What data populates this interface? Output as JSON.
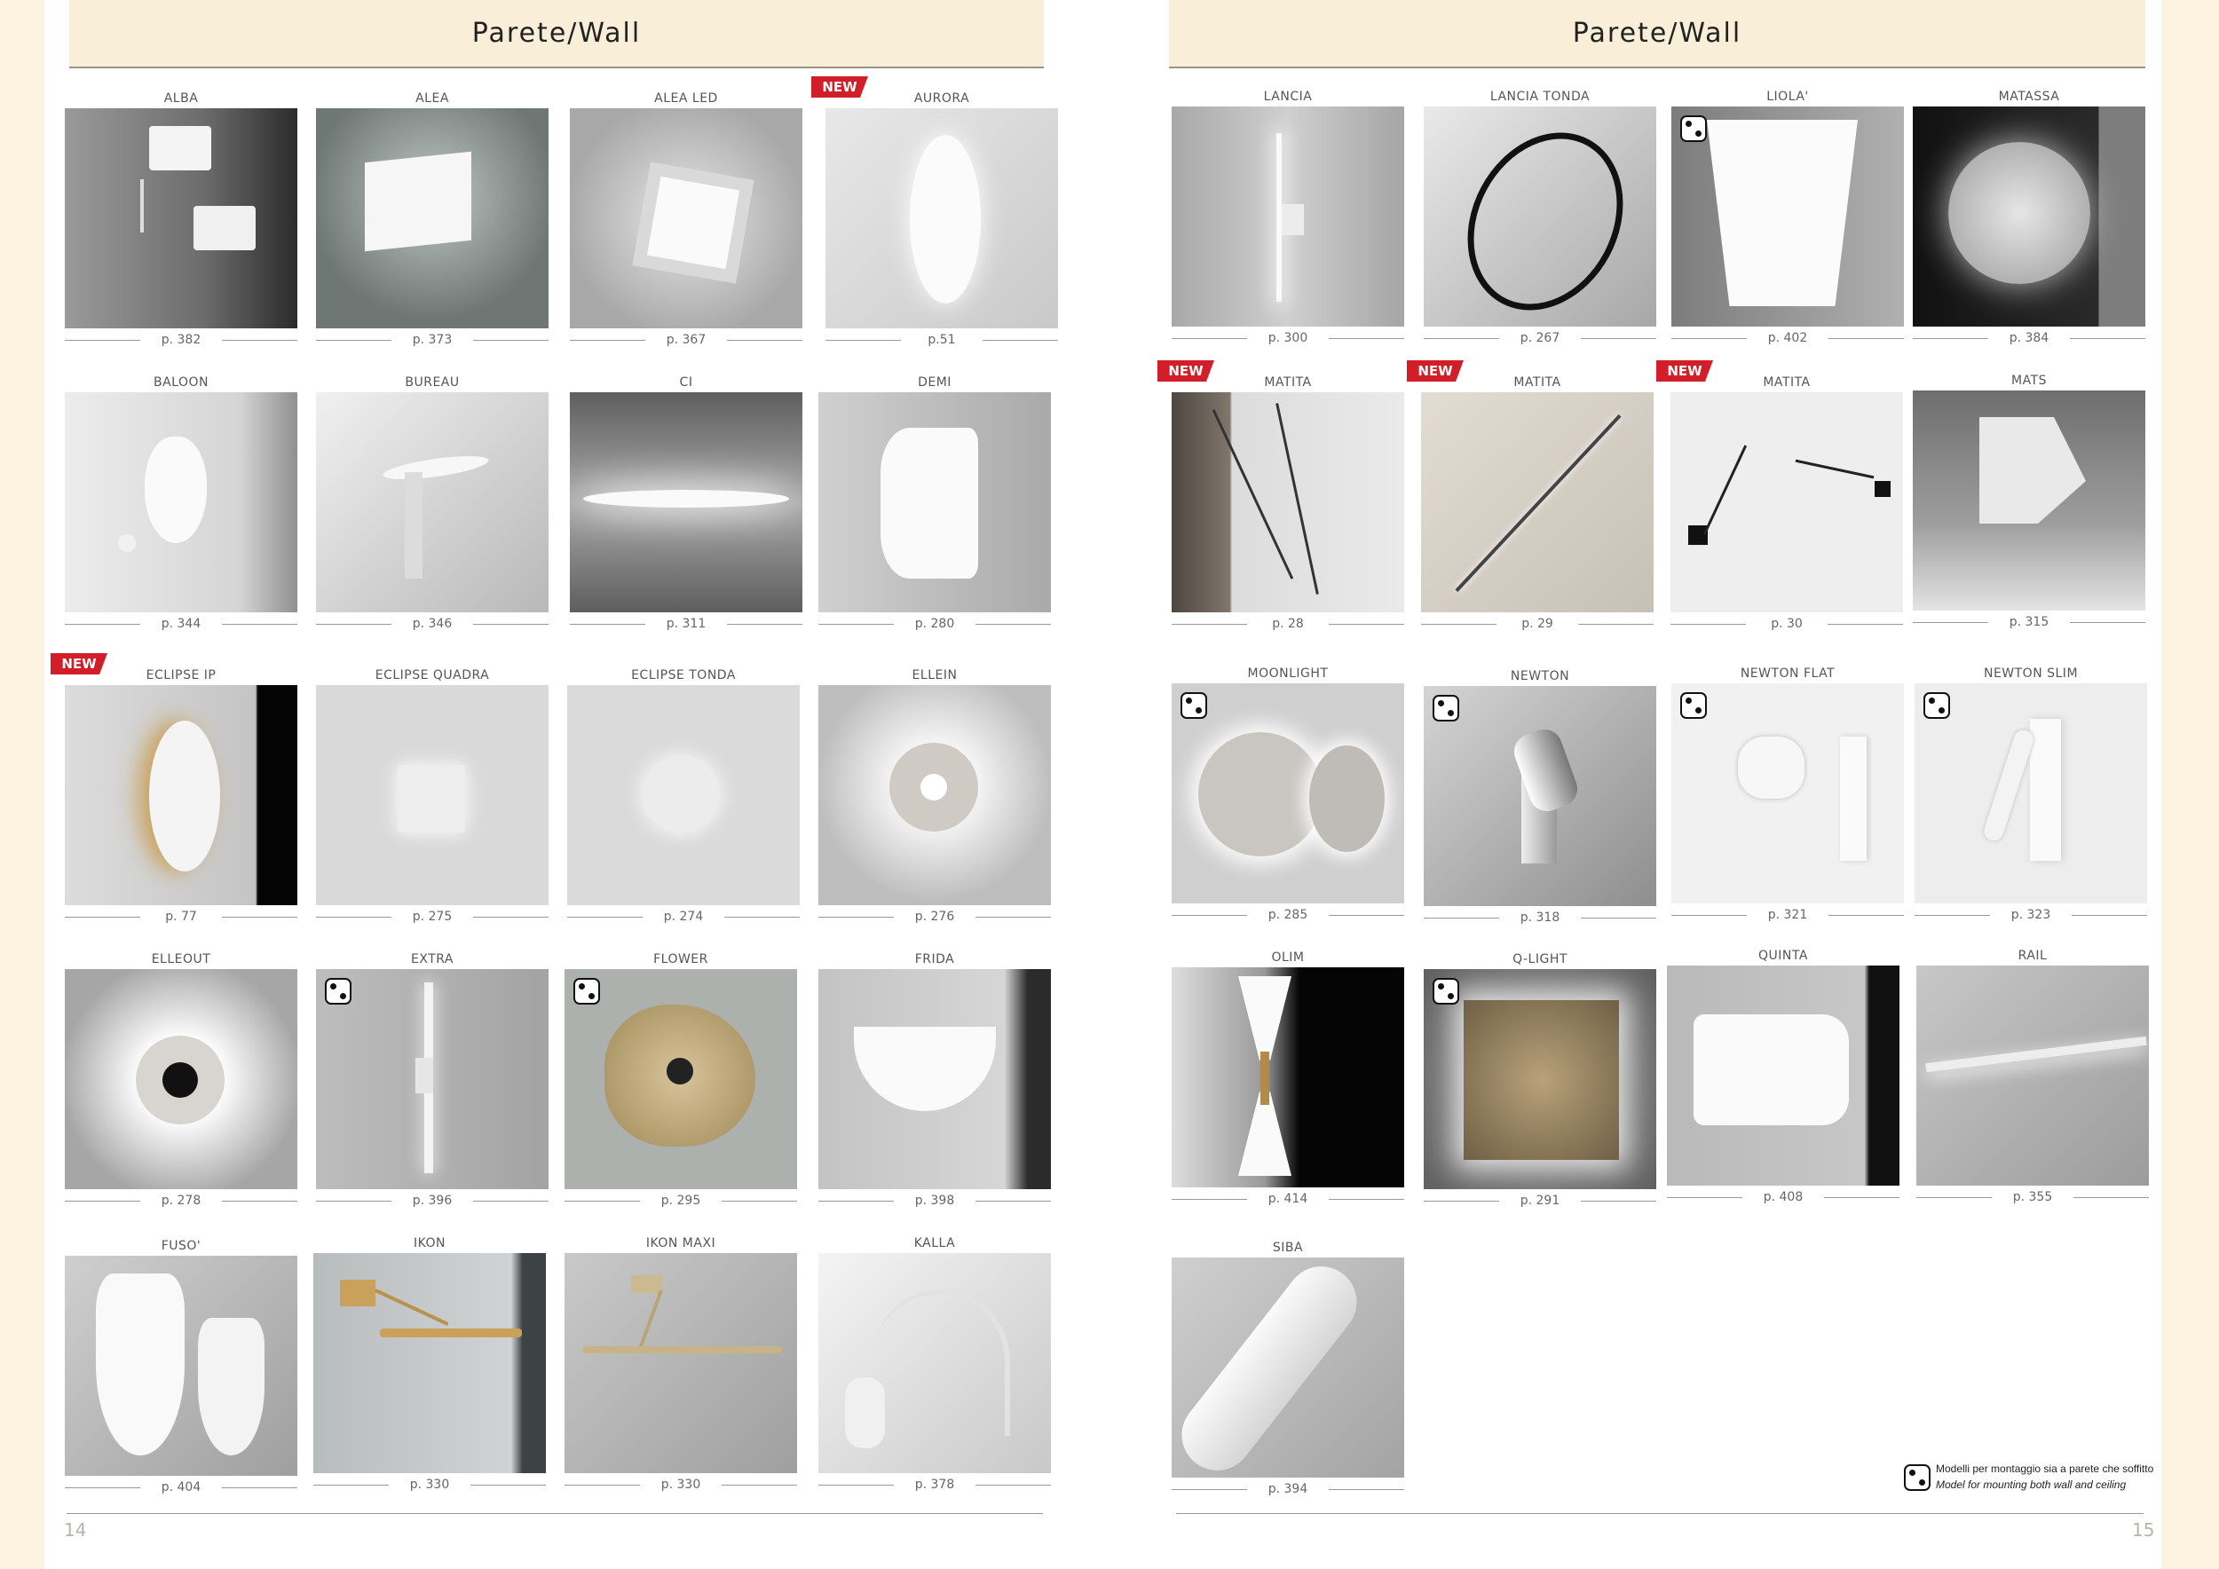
{
  "left_page": {
    "header": "Parete/Wall",
    "page_number": "14",
    "products": [
      {
        "name": "ALBA",
        "page": "p. 382",
        "new": false,
        "dual_mount": false
      },
      {
        "name": "ALEA",
        "page": "p. 373",
        "new": false,
        "dual_mount": false
      },
      {
        "name": "ALEA  LED",
        "page": "p. 367",
        "new": false,
        "dual_mount": false
      },
      {
        "name": "AURORA",
        "page": "p.51",
        "new": true,
        "dual_mount": false
      },
      {
        "name": "BALOON",
        "page": "p. 344",
        "new": false,
        "dual_mount": false
      },
      {
        "name": "BUREAU",
        "page": "p. 346",
        "new": false,
        "dual_mount": false
      },
      {
        "name": "CI",
        "page": "p. 311",
        "new": false,
        "dual_mount": false
      },
      {
        "name": "DEMI",
        "page": "p. 280",
        "new": false,
        "dual_mount": false
      },
      {
        "name": "ECLIPSE IP",
        "page": "p. 77",
        "new": true,
        "dual_mount": false
      },
      {
        "name": "ECLIPSE QUADRA",
        "page": "p. 275",
        "new": false,
        "dual_mount": false
      },
      {
        "name": "ECLIPSE TONDA",
        "page": "p. 274",
        "new": false,
        "dual_mount": false
      },
      {
        "name": "ELLEIN",
        "page": "p. 276",
        "new": false,
        "dual_mount": false
      },
      {
        "name": "ELLEOUT",
        "page": "p. 278",
        "new": false,
        "dual_mount": false
      },
      {
        "name": "EXTRA",
        "page": "p. 396",
        "new": false,
        "dual_mount": true
      },
      {
        "name": "FLOWER",
        "page": "p. 295",
        "new": false,
        "dual_mount": true
      },
      {
        "name": "FRIDA",
        "page": "p. 398",
        "new": false,
        "dual_mount": false
      },
      {
        "name": "FUSO'",
        "page": "p. 404",
        "new": false,
        "dual_mount": false
      },
      {
        "name": "IKON",
        "page": "p. 330",
        "new": false,
        "dual_mount": false
      },
      {
        "name": "IKON MAXI",
        "page": "p. 330",
        "new": false,
        "dual_mount": false
      },
      {
        "name": "KALLA",
        "page": "p. 378",
        "new": false,
        "dual_mount": false
      }
    ]
  },
  "right_page": {
    "header": "Parete/Wall",
    "page_number": "15",
    "products": [
      {
        "name": "LANCIA",
        "page": "p. 300",
        "new": false,
        "dual_mount": false
      },
      {
        "name": "LANCIA TONDA",
        "page": "p. 267",
        "new": false,
        "dual_mount": false
      },
      {
        "name": "LIOLA'",
        "page": "p. 402",
        "new": false,
        "dual_mount": true
      },
      {
        "name": "MATASSA",
        "page": "p. 384",
        "new": false,
        "dual_mount": false
      },
      {
        "name": "MATITA",
        "page": "p. 28",
        "new": true,
        "dual_mount": false
      },
      {
        "name": "MATITA",
        "page": "p. 29",
        "new": true,
        "dual_mount": false
      },
      {
        "name": "MATITA",
        "page": "p. 30",
        "new": true,
        "dual_mount": false
      },
      {
        "name": "MATS",
        "page": "p. 315",
        "new": false,
        "dual_mount": false
      },
      {
        "name": "MOONLIGHT",
        "page": "p. 285",
        "new": false,
        "dual_mount": true
      },
      {
        "name": "NEWTON",
        "page": "p. 318",
        "new": false,
        "dual_mount": true
      },
      {
        "name": "NEWTON FLAT",
        "page": "p. 321",
        "new": false,
        "dual_mount": true
      },
      {
        "name": "NEWTON SLIM",
        "page": "p. 323",
        "new": false,
        "dual_mount": true
      },
      {
        "name": "OLIM",
        "page": "p. 414",
        "new": false,
        "dual_mount": false
      },
      {
        "name": "Q-LIGHT",
        "page": "p. 291",
        "new": false,
        "dual_mount": true
      },
      {
        "name": "QUINTA",
        "page": "p. 408",
        "new": false,
        "dual_mount": false
      },
      {
        "name": "RAIL",
        "page": "p. 355",
        "new": false,
        "dual_mount": false
      },
      {
        "name": "SIBA",
        "page": "p. 394",
        "new": false,
        "dual_mount": false
      }
    ],
    "legend": {
      "line_it": "Modelli per montaggio sia a parete che soffitto",
      "line_en": "Model for mounting both wall and ceiling",
      "icon": "dual-mount-icon"
    }
  },
  "badge_label": "NEW",
  "colors": {
    "background": "#fbf3df",
    "header_band": "#f9efd8",
    "new_badge": "#d11e28"
  }
}
